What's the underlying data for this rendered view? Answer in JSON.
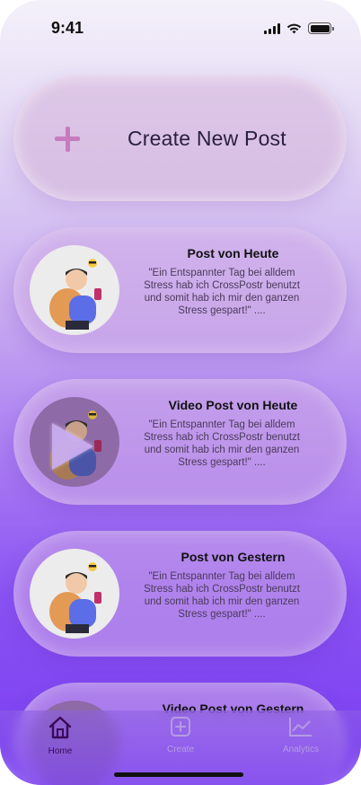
{
  "status": {
    "time": "9:41"
  },
  "create": {
    "label": "Create New Post",
    "icon": "plus-icon",
    "accent": "#c77bbf"
  },
  "posts": [
    {
      "title": "Post von Heute",
      "text": "\"Ein Entspannter Tag bei alldem Stress hab ich CrossPostr benutzt und somit hab ich mir den ganzen Stress gespart!\" ....",
      "type": "image"
    },
    {
      "title": "Video Post von Heute",
      "text": "\"Ein Entspannter Tag bei alldem Stress hab ich CrossPostr benutzt und somit hab ich mir den ganzen Stress gespart!\" ....",
      "type": "video"
    },
    {
      "title": "Post von Gestern",
      "text": "\"Ein Entspannter Tag bei alldem Stress hab ich CrossPostr benutzt und somit hab ich mir den ganzen Stress gespart!\" ....",
      "type": "image"
    },
    {
      "title": "Video Post von Gestern",
      "type": "video"
    }
  ],
  "tabs": [
    {
      "label": "Home",
      "icon": "home-icon",
      "active": true
    },
    {
      "label": "Create",
      "icon": "plus-square-icon",
      "active": false
    },
    {
      "label": "Analytics",
      "icon": "chart-icon",
      "active": false
    }
  ],
  "colors": {
    "active_tab": "#3a0a5a",
    "inactive_tab": "#b59be2",
    "background_top": "#f4f1fa",
    "background_bottom": "#7a3df0"
  }
}
